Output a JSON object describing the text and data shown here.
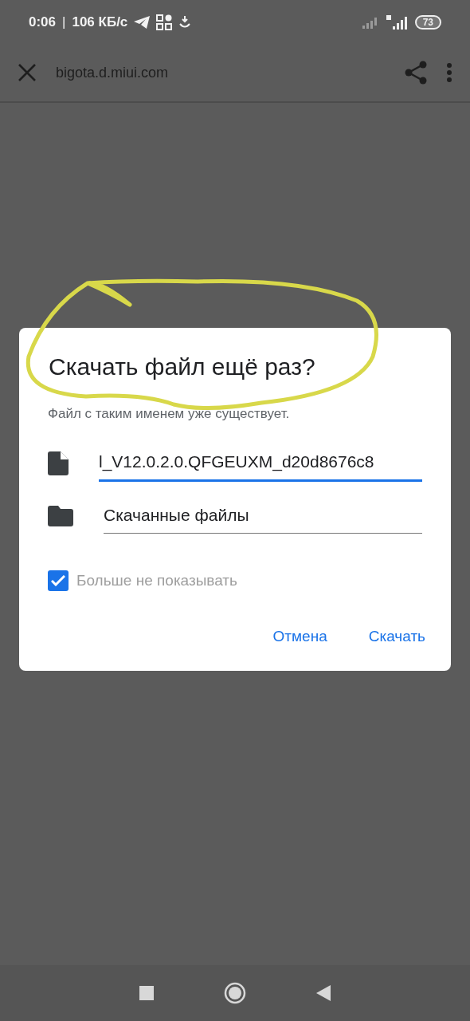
{
  "status_bar": {
    "time": "0:06",
    "separator": "|",
    "speed": "106 КБ/с",
    "battery": "73"
  },
  "toolbar": {
    "url": "bigota.d.miui.com"
  },
  "dialog": {
    "title": "Скачать файл ещё раз?",
    "message": "Файл с таким именем уже существует.",
    "fields": [
      {
        "kind": "file",
        "value": "l_V12.0.2.0.QFGEUXM_d20d8676c8",
        "focused": true
      },
      {
        "kind": "folder",
        "value": "Скачанные файлы",
        "focused": false
      }
    ],
    "checkbox": {
      "label": "Больше не показывать",
      "checked": true
    },
    "buttons": [
      "Отмена",
      "Скачать"
    ]
  },
  "annotation": {
    "kind": "circle"
  }
}
